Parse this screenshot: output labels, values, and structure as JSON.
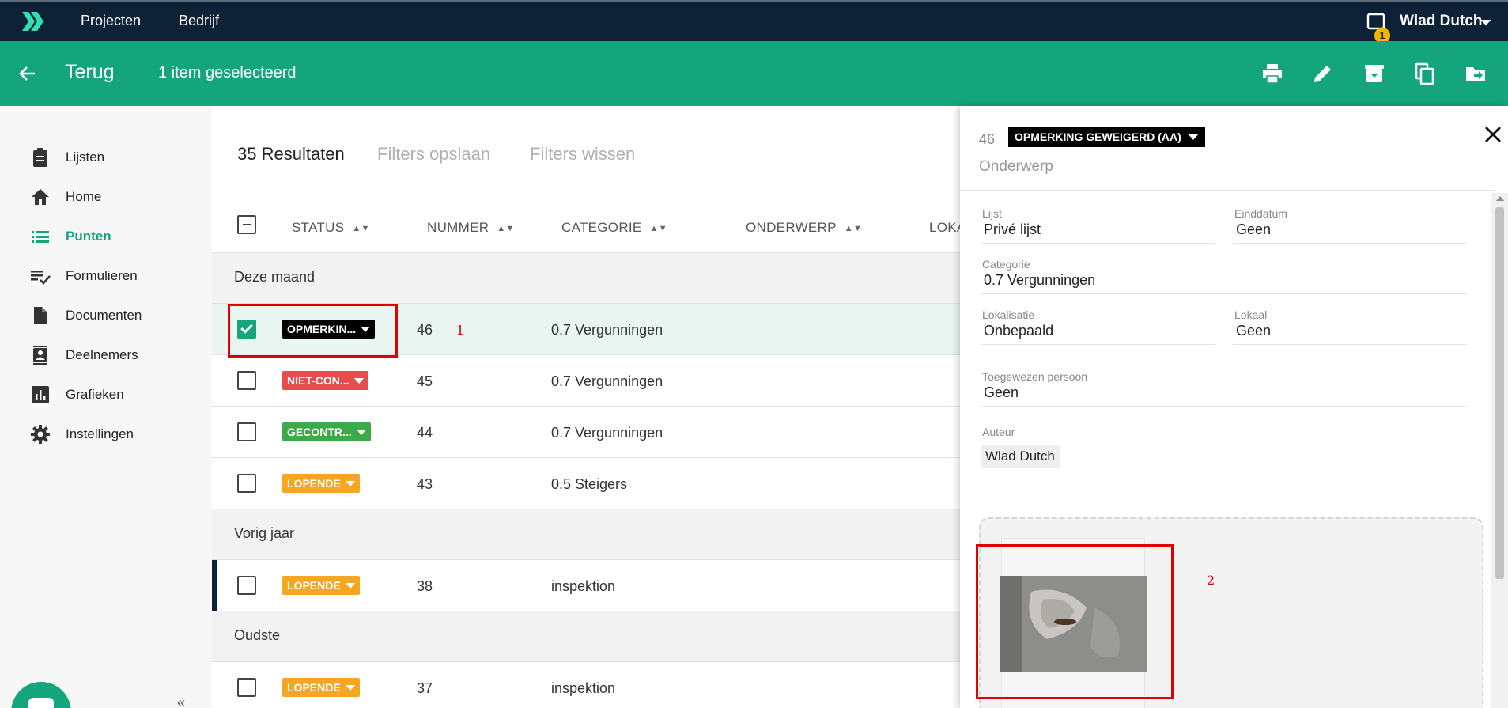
{
  "topbar": {
    "logo_icon": "brand-chevrons-icon",
    "nav": [
      "Projecten",
      "Bedrijf"
    ],
    "notification_count": "1",
    "user_name": "Wlad Dutch"
  },
  "actionbar": {
    "back_label": "Terug",
    "selection_label": "1 item geselecteerd",
    "actions": [
      "print-icon",
      "edit-icon",
      "archive-icon",
      "copy-icon",
      "move-icon"
    ]
  },
  "sidebar": {
    "items": [
      {
        "label": "Lijsten",
        "icon": "clipboard-icon"
      },
      {
        "label": "Home",
        "icon": "home-icon"
      },
      {
        "label": "Punten",
        "icon": "list-icon",
        "active": true
      },
      {
        "label": "Formulieren",
        "icon": "checklist-icon"
      },
      {
        "label": "Documenten",
        "icon": "document-icon"
      },
      {
        "label": "Deelnemers",
        "icon": "contacts-icon"
      },
      {
        "label": "Grafieken",
        "icon": "chart-icon"
      },
      {
        "label": "Instellingen",
        "icon": "gear-icon"
      }
    ],
    "collapse_label": "«"
  },
  "main": {
    "results": "35 Resultaten",
    "filters_save": "Filters opslaan",
    "filters_clear": "Filters wissen",
    "columns": [
      "STATUS",
      "NUMMER",
      "CATEGORIE",
      "ONDERWERP",
      "LOKA"
    ],
    "groups": [
      {
        "label": "Deze maand",
        "rows": [
          {
            "status": "OPMERKIN...",
            "color": "#000000",
            "number": "46",
            "category": "0.7 Vergunningen",
            "checked": true
          },
          {
            "status": "NIET-CON...",
            "color": "#e84c4c",
            "number": "45",
            "category": "0.7 Vergunningen",
            "checked": false
          },
          {
            "status": "GECONTR...",
            "color": "#3daa4a",
            "number": "44",
            "category": "0.7 Vergunningen",
            "checked": false
          },
          {
            "status": "LOPENDE",
            "color": "#f5a623",
            "number": "43",
            "category": "0.5 Steigers",
            "checked": false
          }
        ]
      },
      {
        "label": "Vorig jaar",
        "rows": [
          {
            "status": "LOPENDE",
            "color": "#f5a623",
            "number": "38",
            "category": "inspektion",
            "checked": false
          }
        ]
      },
      {
        "label": "Oudste",
        "rows": [
          {
            "status": "LOPENDE",
            "color": "#f5a623",
            "number": "37",
            "category": "inspektion",
            "checked": false
          }
        ]
      }
    ]
  },
  "annotations": {
    "one": "1",
    "two": "2"
  },
  "panel": {
    "number": "46",
    "status": "OPMERKING GEWEIGERD (AA)",
    "subject_placeholder": "Onderwerp",
    "fields": {
      "lijst": {
        "label": "Lijst",
        "value": "Privé lijst"
      },
      "einddatum": {
        "label": "Einddatum",
        "value": "Geen"
      },
      "categorie": {
        "label": "Categorie",
        "value": "0.7 Vergunningen"
      },
      "lokalisatie": {
        "label": "Lokalisatie",
        "value": "Onbepaald"
      },
      "lokaal": {
        "label": "Lokaal",
        "value": "Geen"
      },
      "toegewezen": {
        "label": "Toegewezen persoon",
        "value": "Geen"
      }
    },
    "author_label": "Auteur",
    "author_value": "Wlad Dutch"
  }
}
